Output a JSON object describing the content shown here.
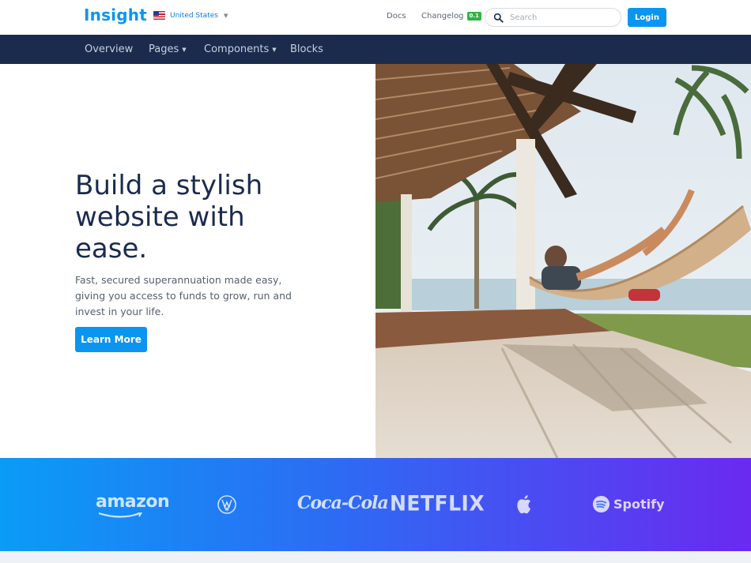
{
  "header": {
    "brand": "Insight",
    "country": "United States",
    "links": {
      "docs": "Docs",
      "changelog": "Changelog",
      "changelog_badge": "0.1"
    },
    "search_placeholder": "Search",
    "login_label": "Login"
  },
  "nav": {
    "items": [
      {
        "label": "Overview",
        "dropdown": false
      },
      {
        "label": "Pages",
        "dropdown": true
      },
      {
        "label": "Components",
        "dropdown": true
      },
      {
        "label": "Blocks",
        "dropdown": false
      }
    ]
  },
  "hero": {
    "title": "Build a stylish website with ease.",
    "subtitle": "Fast, secured superannuation made easy, giving you access to funds to grow, run and invest in your life.",
    "cta_label": "Learn More"
  },
  "logos": {
    "amazon": "amazon",
    "volkswagen_icon": "volkswagen-logo",
    "cocacola": "Coca-Cola",
    "netflix": "NETFLIX",
    "apple_icon": "apple-logo",
    "spotify": "Spotify"
  },
  "colors": {
    "brand": "#0a95f0",
    "nav_bg": "#1b2b4e",
    "heading": "#1b2b4e",
    "badge": "#2fb344",
    "gradient_start": "#0a9cf6",
    "gradient_end": "#6a2af0"
  }
}
